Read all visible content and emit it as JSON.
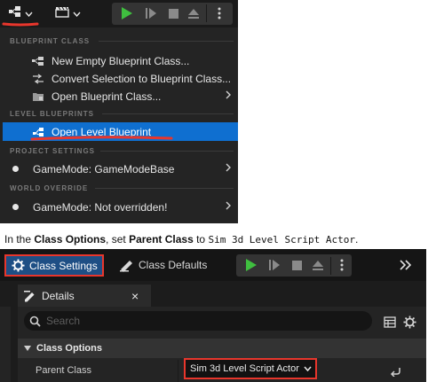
{
  "top_screenshot": {
    "toolbar": {
      "blueprint_icon": "blueprint-icon",
      "cinematics_icon": "clapperboard-icon"
    },
    "menu": {
      "sections": [
        {
          "header": "BLUEPRINT CLASS",
          "items": [
            {
              "label": "New Empty Blueprint Class...",
              "icon": "blueprint-class-icon",
              "submenu": false
            },
            {
              "label": "Convert Selection to Blueprint Class...",
              "icon": "convert-icon",
              "submenu": false
            },
            {
              "label": "Open Blueprint Class...",
              "icon": "folder-blueprint-icon",
              "submenu": true
            }
          ]
        },
        {
          "header": "LEVEL BLUEPRINTS",
          "items": [
            {
              "label": "Open Level Blueprint",
              "icon": "level-blueprint-icon",
              "submenu": false,
              "selected": true
            }
          ]
        },
        {
          "header": "PROJECT SETTINGS",
          "items": [
            {
              "label": "GameMode: GameModeBase",
              "icon": "dot",
              "submenu": true
            }
          ]
        },
        {
          "header": "WORLD OVERRIDE",
          "items": [
            {
              "label": "GameMode: Not overridden!",
              "icon": "dot",
              "submenu": true
            }
          ]
        }
      ]
    }
  },
  "instruction": {
    "prefix": "In the ",
    "class_options": "Class Options",
    "middle": ", set ",
    "parent_class": "Parent Class",
    "to": " to ",
    "value": "Sim 3d Level Script Actor",
    "suffix": "."
  },
  "bottom_screenshot": {
    "toolbar": {
      "class_settings": "Class Settings",
      "class_defaults": "Class Defaults"
    },
    "details_tab": {
      "label": "Details",
      "close": "×"
    },
    "search": {
      "placeholder": "Search"
    },
    "category": "Class Options",
    "property": {
      "name": "Parent Class",
      "value": "Sim 3d Level Script Actor"
    }
  },
  "colors": {
    "highlight": "#e8362c",
    "selection": "#0f6fd0",
    "play_green": "#3fbf3f"
  }
}
